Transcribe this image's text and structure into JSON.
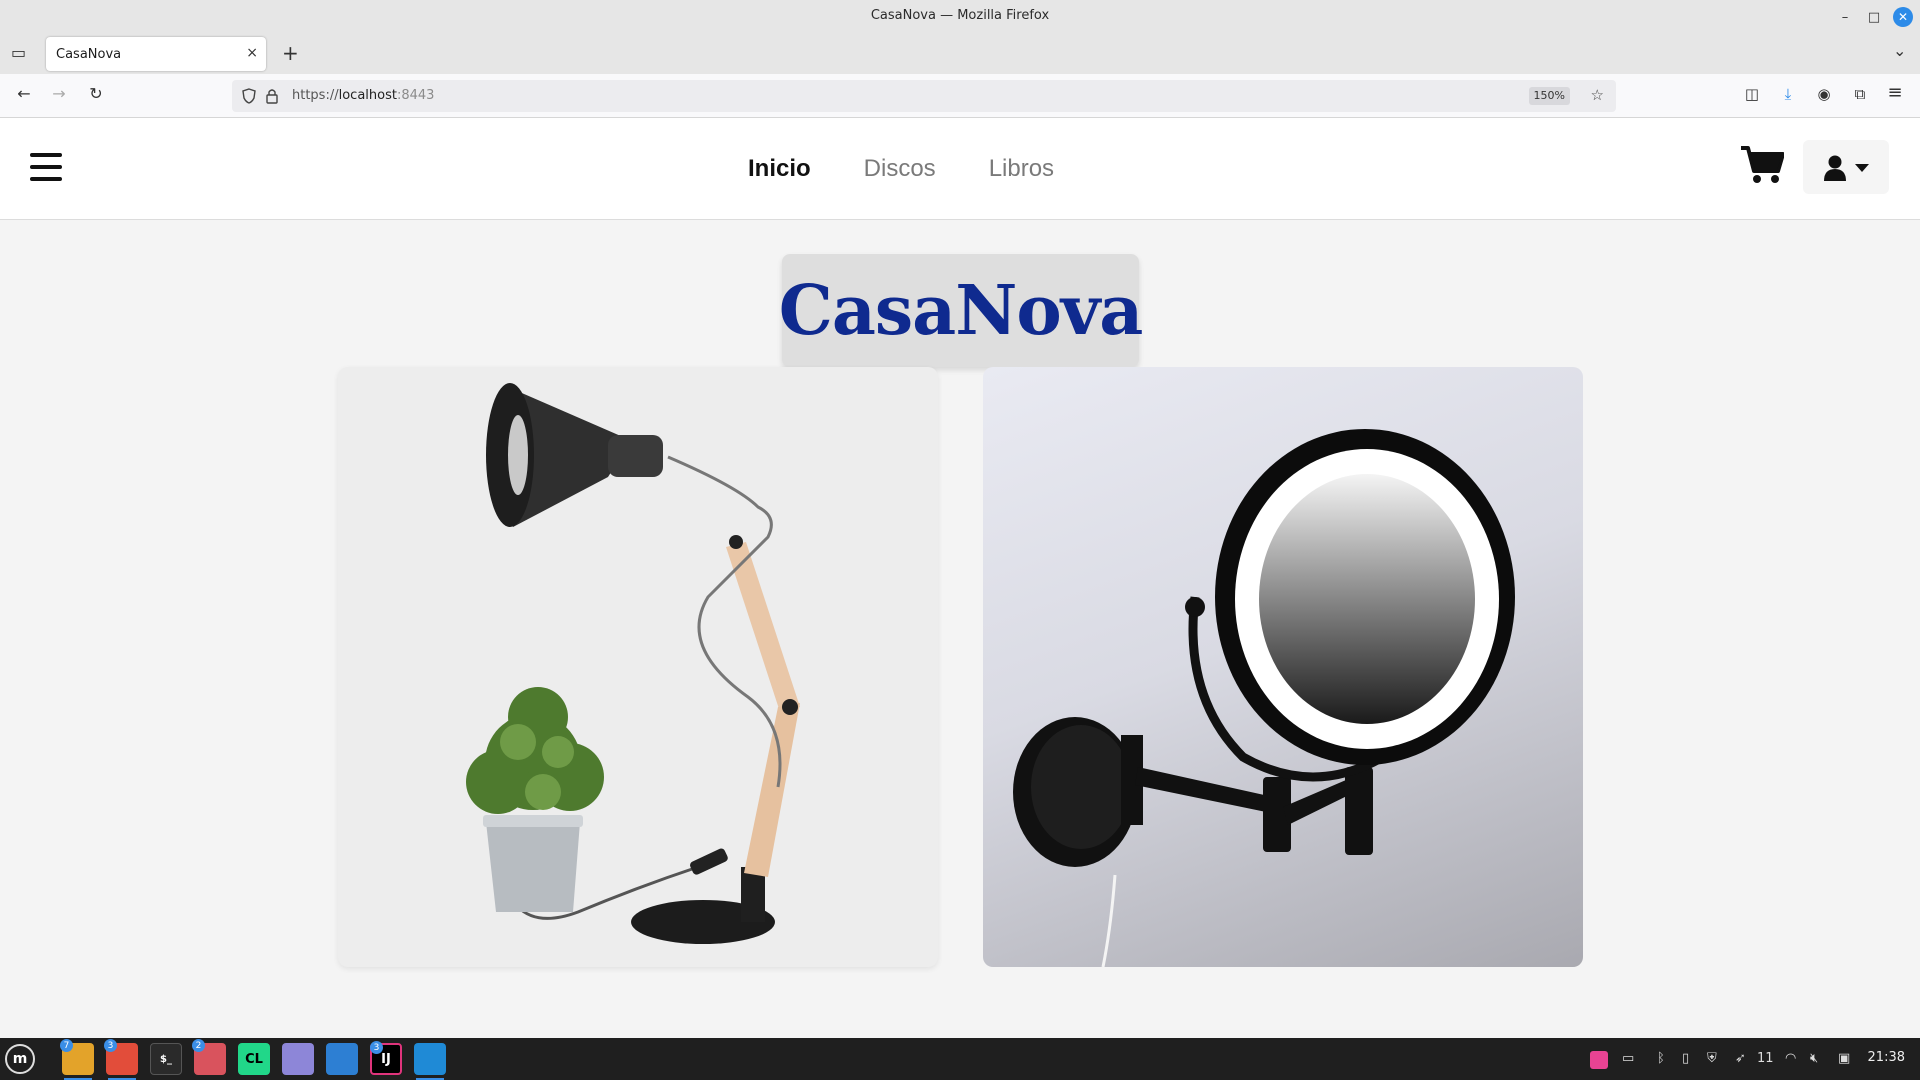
{
  "window": {
    "title": "CasaNova — Mozilla Firefox",
    "minimize": "–",
    "maximize": "□",
    "close": "✕"
  },
  "tabs": [
    {
      "label": "CasaNova",
      "close": "×"
    }
  ],
  "tabstrip": {
    "new_tab": "+",
    "list_all": "⌄",
    "tab_manager": "▭"
  },
  "nav": {
    "back": "←",
    "forward": "→",
    "reload": "↻",
    "url_prefix": "https://",
    "url_host": "localhost",
    "url_port": ":8443",
    "zoom": "150%",
    "bookmark_star": "☆",
    "pocket": "◫",
    "downloads": "⤓",
    "account": "◉",
    "extensions": "⧉",
    "menu": "≡"
  },
  "site": {
    "menu_items": [
      {
        "label": "Inicio",
        "active": true
      },
      {
        "label": "Discos",
        "active": false
      },
      {
        "label": "Libros",
        "active": false
      }
    ],
    "brand": "CasaNova",
    "brand_color": "#0f2a8f"
  },
  "products": [
    {
      "name": "lamp-image"
    },
    {
      "name": "mirror-image"
    }
  ],
  "taskbar": {
    "apps": [
      {
        "name": "files",
        "badge": "7"
      },
      {
        "name": "firefox",
        "badge": "3"
      },
      {
        "name": "terminal",
        "badge": ""
      },
      {
        "name": "app-red",
        "badge": "2"
      },
      {
        "name": "clion",
        "label": "CL",
        "badge": ""
      },
      {
        "name": "text-editor",
        "badge": ""
      },
      {
        "name": "writer",
        "badge": ""
      },
      {
        "name": "intellij",
        "label": "IJ",
        "badge": "3"
      },
      {
        "name": "vscode",
        "badge": ""
      }
    ],
    "tray_count": "11",
    "clock": "21:38"
  }
}
